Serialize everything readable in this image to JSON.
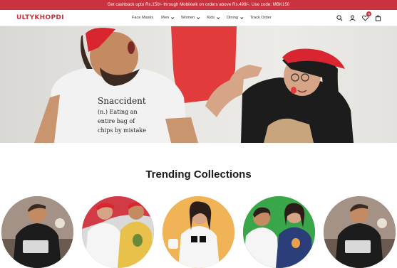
{
  "promo": {
    "text": "Get cashback upto Rs.150/- through Mobikwik on orders above Rs.499/-. Use code: MBK150"
  },
  "header": {
    "logo": "ULTYKHOPDI",
    "nav": [
      {
        "label": "Face Masks",
        "dropdown": false
      },
      {
        "label": "Men",
        "dropdown": true
      },
      {
        "label": "Women",
        "dropdown": true
      },
      {
        "label": "Kids",
        "dropdown": true
      },
      {
        "label": "Dining",
        "dropdown": true
      },
      {
        "label": "Track Order",
        "dropdown": false
      }
    ],
    "icons": [
      "search-icon",
      "user-icon",
      "wishlist-icon",
      "cart-icon"
    ],
    "wishlist_count": "0"
  },
  "hero": {
    "shirt_title": "Snaccident",
    "shirt_line1": "(n.) Eating an",
    "shirt_line2": "entire bag of",
    "shirt_line3": "chips by mistake"
  },
  "sections": {
    "trending_title": "Trending Collections"
  },
  "colors": {
    "brand": "#c8333f",
    "cap_red": "#d9252f",
    "paint_red": "#e23b3b",
    "shirt_white": "#f2f2f2",
    "shirt_black": "#1c1c1c"
  }
}
